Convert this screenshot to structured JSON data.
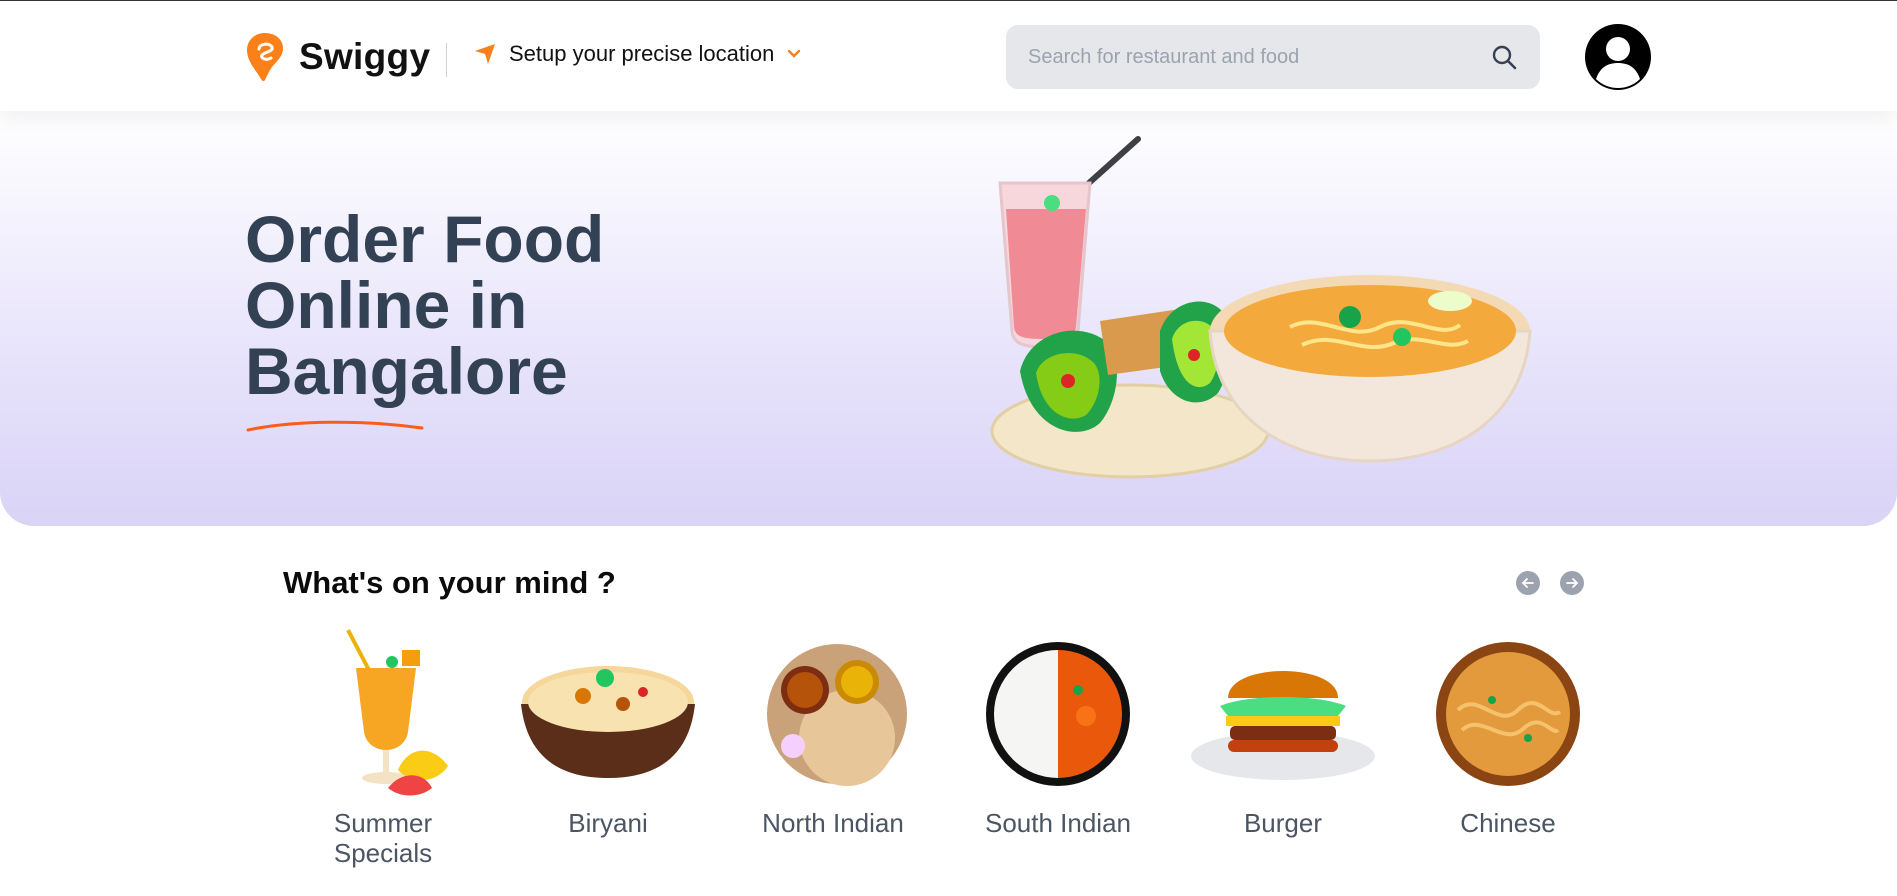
{
  "header": {
    "brand": "Swiggy",
    "location_label": "Setup your precise location",
    "search_placeholder": "Search for restaurant and food"
  },
  "hero": {
    "title_lines": [
      "Order Food",
      "Online in",
      "Bangalore"
    ]
  },
  "section": {
    "title": "What's on your mind ?"
  },
  "cuisines": [
    {
      "label": "Summer Specials"
    },
    {
      "label": "Biryani"
    },
    {
      "label": "North Indian"
    },
    {
      "label": "South Indian"
    },
    {
      "label": "Burger"
    },
    {
      "label": "Chinese"
    }
  ],
  "colors": {
    "accent": "#fc8019",
    "title": "#334155",
    "hero_bg": "#e3ddf8"
  },
  "icons": {
    "logo": "swiggy-logo-icon",
    "location": "location-arrow-icon",
    "dropdown": "chevron-down-icon",
    "search": "search-icon",
    "profile": "user-avatar-icon",
    "prev": "arrow-left-icon",
    "next": "arrow-right-icon"
  }
}
